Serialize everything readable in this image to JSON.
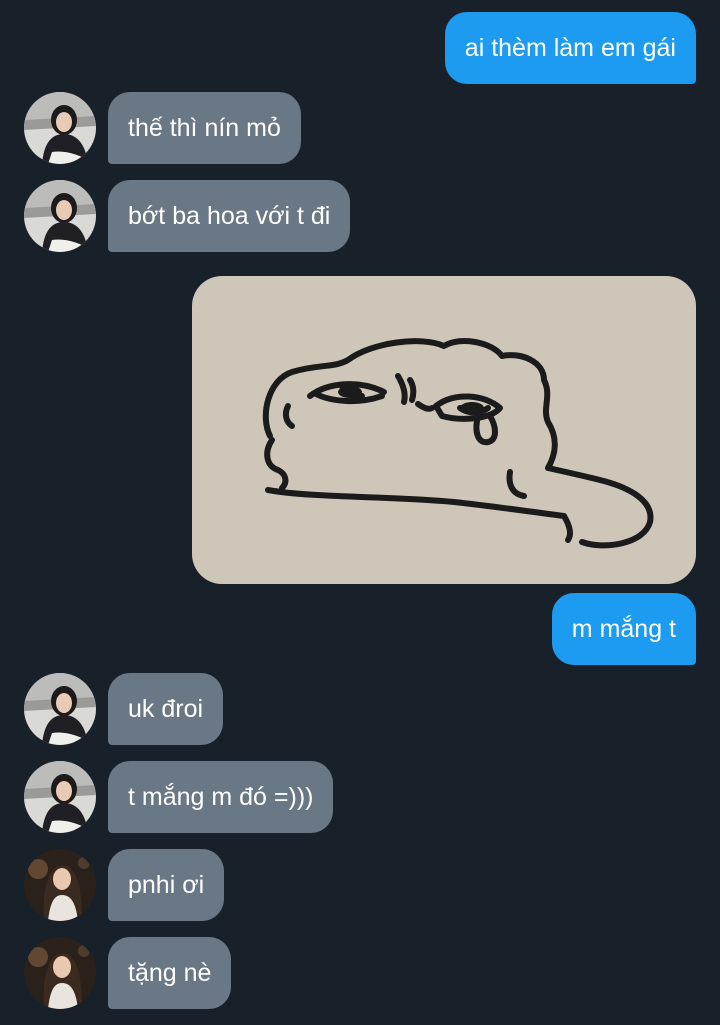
{
  "messages": [
    {
      "side": "out",
      "text": "ai thèm làm em gái"
    },
    {
      "side": "in",
      "text": "thế thì nín mỏ",
      "avatar": "avatar-a"
    },
    {
      "side": "in",
      "text": "bớt ba hoa với t đi",
      "avatar": "avatar-a"
    },
    {
      "side": "out",
      "type": "sticker",
      "icon": "frog-meme-sticker"
    },
    {
      "side": "out",
      "text": "m mắng t"
    },
    {
      "side": "in",
      "text": "uk đroi",
      "avatar": "avatar-a"
    },
    {
      "side": "in",
      "text": "t mắng m đó =)))",
      "avatar": "avatar-a"
    },
    {
      "side": "in",
      "text": "pnhi ơi",
      "avatar": "avatar-b"
    },
    {
      "side": "in",
      "text": "tặng nè",
      "avatar": "avatar-b"
    }
  ],
  "colors": {
    "background": "#18202a",
    "outgoing_bubble": "#1d9bf0",
    "incoming_bubble": "#6a7785",
    "sticker_background": "#cec6b9"
  }
}
